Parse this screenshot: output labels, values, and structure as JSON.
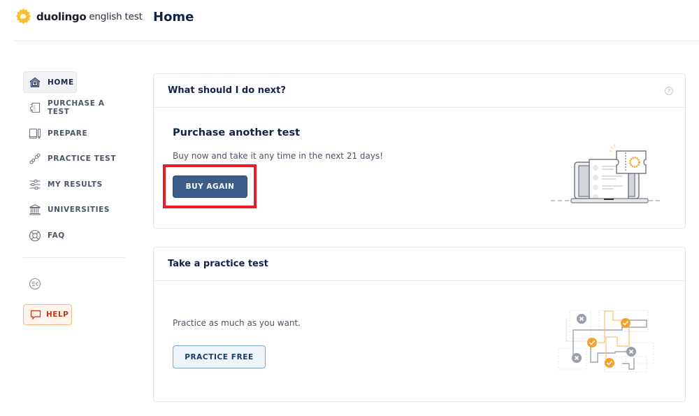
{
  "header": {
    "logo_brand": "duolingo",
    "logo_suffix": "english test",
    "page_title": "Home",
    "brand_color": "#f7c031"
  },
  "sidebar": {
    "items": [
      {
        "label": "HOME",
        "icon": "home-icon",
        "active": true
      },
      {
        "label": "PURCHASE A TEST",
        "icon": "ticket-icon",
        "active": false
      },
      {
        "label": "PREPARE",
        "icon": "book-icon",
        "active": false
      },
      {
        "label": "PRACTICE TEST",
        "icon": "dumbbell-icon",
        "active": false
      },
      {
        "label": "MY RESULTS",
        "icon": "sliders-icon",
        "active": false
      },
      {
        "label": "UNIVERSITIES",
        "icon": "institution-icon",
        "active": false
      },
      {
        "label": "FAQ",
        "icon": "lifebuoy-icon",
        "active": false
      }
    ],
    "collapse_icon": "collapse-sidebar-icon",
    "help_label": "HELP",
    "help_icon": "chat-bubble-icon"
  },
  "cards": {
    "next_steps": {
      "title": "What should I do next?",
      "info_icon_glyph": "?",
      "subtitle": "Purchase another test",
      "text": "Buy now and take it any time in the next 21 days!",
      "button_label": "BUY AGAIN",
      "button_color": "#3b5d8a",
      "highlight_color": "#ec1c24"
    },
    "practice": {
      "title": "Take a practice test",
      "text": "Practice as much as you want.",
      "button_label": "PRACTICE FREE"
    }
  }
}
